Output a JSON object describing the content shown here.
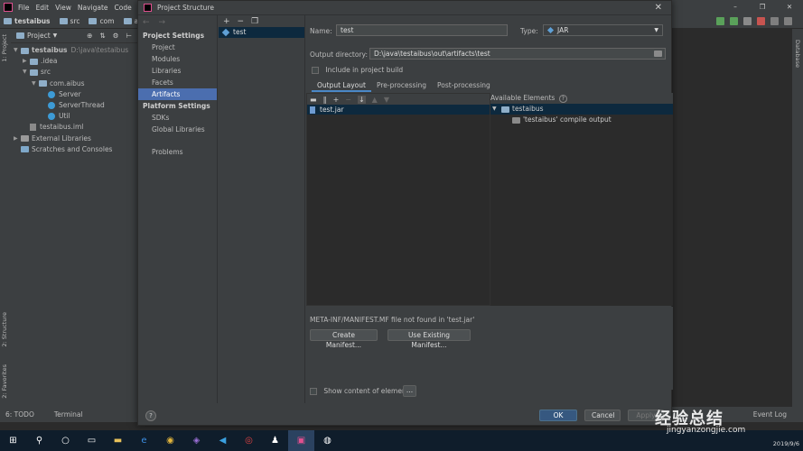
{
  "ide": {
    "menu": [
      "File",
      "Edit",
      "View",
      "Navigate",
      "Code"
    ],
    "breadcrumbs": [
      "testaibus",
      "src",
      "com",
      "aibus"
    ],
    "project_panel": {
      "title": "Project",
      "tree": [
        {
          "label": "testaibus",
          "extra": "D:\\java\\testaibus",
          "depth": 0,
          "arrow": "▼",
          "icon": "folder"
        },
        {
          "label": ".idea",
          "depth": 1,
          "arrow": "▶",
          "icon": "folder"
        },
        {
          "label": "src",
          "depth": 1,
          "arrow": "▼",
          "icon": "folder"
        },
        {
          "label": "com.aibus",
          "depth": 2,
          "arrow": "▼",
          "icon": "folder"
        },
        {
          "label": "Server",
          "depth": 3,
          "arrow": "",
          "icon": "class"
        },
        {
          "label": "ServerThread",
          "depth": 3,
          "arrow": "",
          "icon": "class"
        },
        {
          "label": "Util",
          "depth": 3,
          "arrow": "",
          "icon": "class"
        },
        {
          "label": "testaibus.iml",
          "depth": 1,
          "arrow": "",
          "icon": "file"
        },
        {
          "label": "External Libraries",
          "depth": 0,
          "arrow": "▶",
          "icon": "lib"
        },
        {
          "label": "Scratches and Consoles",
          "depth": 0,
          "arrow": "",
          "icon": "scratch"
        }
      ]
    },
    "left_tabs": [
      "1: Project",
      "2: Structure",
      "2: Favorites"
    ],
    "right_tab": "Database",
    "bottom_tabs": [
      "6: TODO",
      "Terminal"
    ],
    "event_log": "Event Log"
  },
  "dialog": {
    "title": "Project Structure",
    "nav": {
      "project_settings_header": "Project Settings",
      "project_settings": [
        "Project",
        "Modules",
        "Libraries",
        "Facets",
        "Artifacts"
      ],
      "selected": "Artifacts",
      "platform_settings_header": "Platform Settings",
      "platform_settings": [
        "SDKs",
        "Global Libraries"
      ],
      "problems": "Problems"
    },
    "artifacts": [
      "test"
    ],
    "name_label": "Name:",
    "name_value": "test",
    "type_label": "Type:",
    "type_value": "JAR",
    "output_label": "Output directory:",
    "output_value": "D:\\java\\testaibus\\out\\artifacts\\test",
    "include_build": "Include in project build",
    "tabs": [
      "Output Layout",
      "Pre-processing",
      "Post-processing"
    ],
    "selected_tab": "Output Layout",
    "layout_items": [
      "test.jar"
    ],
    "available_label": "Available Elements",
    "available_items": [
      {
        "label": "testaibus",
        "depth": 0
      },
      {
        "label": "'testaibus' compile output",
        "depth": 1
      }
    ],
    "manifest_warning": "META-INF/MANIFEST.MF file not found in 'test.jar'",
    "create_manifest": "Create Manifest...",
    "use_existing_manifest": "Use Existing Manifest...",
    "show_content": "Show content of elements",
    "ellipsis": "...",
    "ok": "OK",
    "cancel": "Cancel",
    "apply": "Apply",
    "help": "?"
  },
  "taskbar": {
    "date": "2019/9/6"
  },
  "watermark": {
    "text": "经验总结",
    "url": "jingyanzongjie.com"
  },
  "colors": {
    "selection": "#4b6eaf",
    "tree_selection": "#0d293e",
    "primary_button": "#365880",
    "panel": "#3c3f41",
    "editor": "#2b2b2b"
  }
}
